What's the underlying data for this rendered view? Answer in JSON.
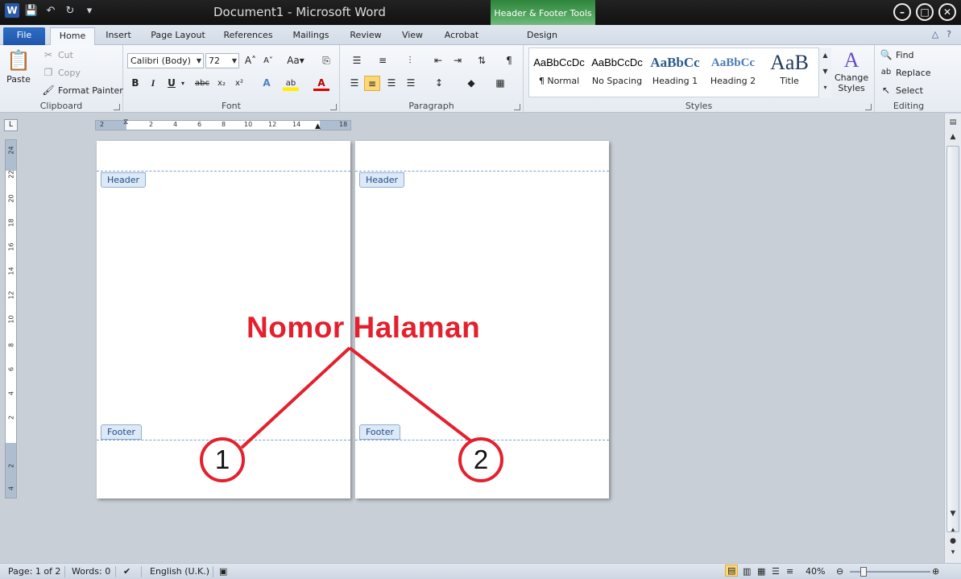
{
  "window": {
    "doc_name": "Document1",
    "separator": "-",
    "app_name": "Microsoft Word",
    "context_tab_group": "Header & Footer Tools"
  },
  "tabs": [
    {
      "label": "File"
    },
    {
      "label": "Home"
    },
    {
      "label": "Insert"
    },
    {
      "label": "Page Layout"
    },
    {
      "label": "References"
    },
    {
      "label": "Mailings"
    },
    {
      "label": "Review"
    },
    {
      "label": "View"
    },
    {
      "label": "Acrobat"
    },
    {
      "label": "Design"
    }
  ],
  "clipboard": {
    "paste": "Paste",
    "cut": "Cut",
    "copy": "Copy",
    "format_painter": "Format Painter",
    "label": "Clipboard"
  },
  "font": {
    "family": "Calibri (Body)",
    "size": "72",
    "label": "Font"
  },
  "paragraph": {
    "label": "Paragraph"
  },
  "styles": {
    "label": "Styles",
    "items": [
      {
        "preview": "AaBbCcDc",
        "name": "¶ Normal"
      },
      {
        "preview": "AaBbCcDc",
        "name": "No Spacing"
      },
      {
        "preview": "AaBbCc",
        "name": "Heading 1"
      },
      {
        "preview": "AaBbCc",
        "name": "Heading 2"
      },
      {
        "preview": "AaB",
        "name": "Title"
      }
    ],
    "change_styles_1": "Change",
    "change_styles_2": "Styles"
  },
  "editing": {
    "find": "Find",
    "replace": "Replace",
    "select": "Select",
    "label": "Editing"
  },
  "ruler": {
    "h_ticks": [
      "2",
      "2",
      "4",
      "6",
      "8",
      "10",
      "12",
      "14",
      "18"
    ],
    "v_ticks": [
      "24",
      "22",
      "20",
      "18",
      "16",
      "14",
      "12",
      "10",
      "8",
      "6",
      "4",
      "2",
      "2",
      "4"
    ]
  },
  "pages": [
    {
      "header_tag": "Header",
      "footer_tag": "Footer",
      "page_number": "1"
    },
    {
      "header_tag": "Header",
      "footer_tag": "Footer",
      "page_number": "2"
    }
  ],
  "annotation": {
    "text": "Nomor Halaman",
    "color": "#e3212e"
  },
  "status": {
    "page": "Page: 1 of 2",
    "words": "Words: 0",
    "language": "English (U.K.)",
    "zoom": "40%"
  },
  "colors": {
    "file_tab": "#2f6cc4",
    "context_green": "#2f8a3c",
    "selected_button": "#fbd777"
  }
}
